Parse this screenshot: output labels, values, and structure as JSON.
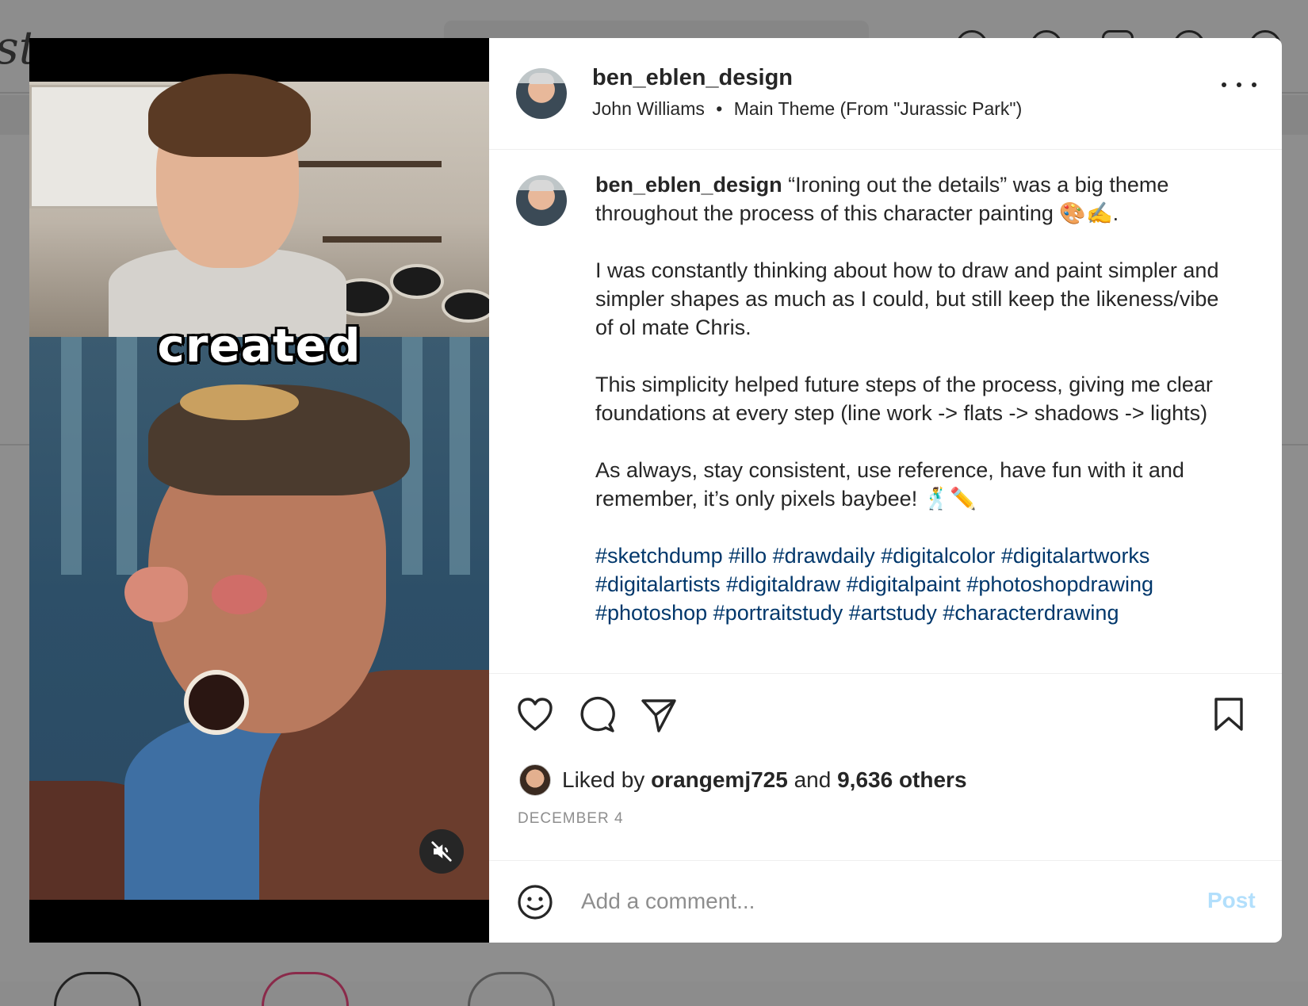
{
  "background": {
    "logo_fragment": "sta"
  },
  "video": {
    "caption_word": "created",
    "muted": true
  },
  "post": {
    "author": "ben_eblen_design",
    "audio_artist": "John Williams",
    "audio_separator": "•",
    "audio_track": "Main Theme (From \"Jurassic Park\")",
    "caption_author": "ben_eblen_design",
    "caption_paragraphs": [
      "“Ironing out the details” was a big theme throughout the process of this character painting 🎨✍️.",
      "I was constantly thinking about how to draw and paint simpler and simpler shapes as much as I could, but still keep the likeness/vibe of ol mate Chris.",
      "This simplicity helped future steps of the process, giving me clear foundations at every step (line work -> flats -> shadows -> lights)",
      "As always, stay consistent, use reference, have fun with it and remember, it’s only pixels baybee! 🕺✏️"
    ],
    "hashtags": [
      "#sketchdump",
      "#illo",
      "#drawdaily",
      "#digitalcolor",
      "#digitalartworks",
      "#digitalartists",
      "#digitaldraw",
      "#digitalpaint",
      "#photoshopdrawing",
      "#photoshop",
      "#portraitstudy",
      "#artstudy",
      "#characterdrawing"
    ],
    "likes": {
      "prefix": "Liked by",
      "user": "orangemj725",
      "connector": "and",
      "others": "9,636 others"
    },
    "date": "DECEMBER 4"
  },
  "comment": {
    "placeholder": "Add a comment...",
    "post_label": "Post"
  },
  "colors": {
    "hashtag": "#00376b",
    "post_button_disabled": "#b2dffc",
    "overlay": "#8e8e8e"
  }
}
